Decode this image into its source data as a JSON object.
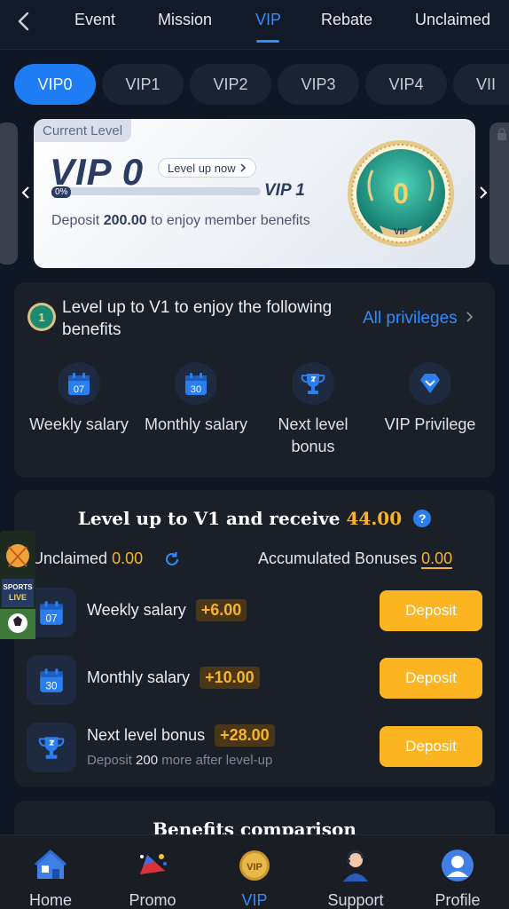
{
  "topnav": {
    "back_icon": "chevron-left-icon",
    "tabs": [
      {
        "label": "Event"
      },
      {
        "label": "Mission"
      },
      {
        "label": "VIP"
      },
      {
        "label": "Rebate"
      },
      {
        "label": "Unclaimed"
      }
    ],
    "active_tab": "VIP"
  },
  "levels": [
    "VIP0",
    "VIP1",
    "VIP2",
    "VIP3",
    "VIP4",
    "VII"
  ],
  "active_level": "VIP0",
  "card": {
    "tag": "Current Level",
    "level": "VIP 0",
    "level_up_label": "Level up now",
    "progress_label": "0%",
    "progress": 0,
    "next_level": "VIP 1",
    "deposit_prefix": "Deposit",
    "deposit_amount": "200.00",
    "deposit_suffix": "to enjoy member benefits",
    "badge_text": "0",
    "badge_caption": "VIP"
  },
  "benefits_panel": {
    "badge_text": "1",
    "heading": "Level up to V1 to enjoy the following benefits",
    "all_privileges": "All privileges",
    "items": [
      {
        "label": "Weekly salary",
        "icon": "calendar-icon",
        "icon_text": "07"
      },
      {
        "label": "Monthly salary",
        "icon": "calendar-icon",
        "icon_text": "30"
      },
      {
        "label": "Next level bonus",
        "icon": "trophy-icon"
      },
      {
        "label": "VIP Privilege",
        "icon": "diamond-icon"
      }
    ]
  },
  "receive_panel": {
    "title_prefix": "Level up to V1 and receive",
    "title_amount": "44.00",
    "help": "?",
    "unclaimed_label": "Unclaimed",
    "unclaimed_value": "0.00",
    "accumulated_label": "Accumulated Bonuses",
    "accumulated_value": "0.00",
    "rows": [
      {
        "label": "Weekly salary",
        "bonus": "+6.00",
        "button": "Deposit",
        "icon_text": "07"
      },
      {
        "label": "Monthly salary",
        "bonus": "+10.00",
        "button": "Deposit",
        "icon_text": "30"
      },
      {
        "label": "Next level bonus",
        "bonus": "+28.00",
        "button": "Deposit",
        "sub_prefix": "Deposit",
        "sub_amount": "200",
        "sub_suffix": "more after level-up"
      }
    ]
  },
  "sports_widget": {
    "line1": "SPORTS",
    "line2": "LIVE"
  },
  "comparison_title": "Benefits comparison",
  "bottomnav": {
    "items": [
      {
        "label": "Home",
        "icon": "home-icon"
      },
      {
        "label": "Promo",
        "icon": "promo-icon"
      },
      {
        "label": "VIP",
        "icon": "vip-icon"
      },
      {
        "label": "Support",
        "icon": "support-agent-icon"
      },
      {
        "label": "Profile",
        "icon": "profile-icon"
      }
    ],
    "active": "VIP"
  },
  "colors": {
    "accent": "#2f8cff",
    "gold": "#f7b329",
    "button": "#fcb521",
    "background": "#0f1624",
    "panel": "#1b1f28"
  }
}
